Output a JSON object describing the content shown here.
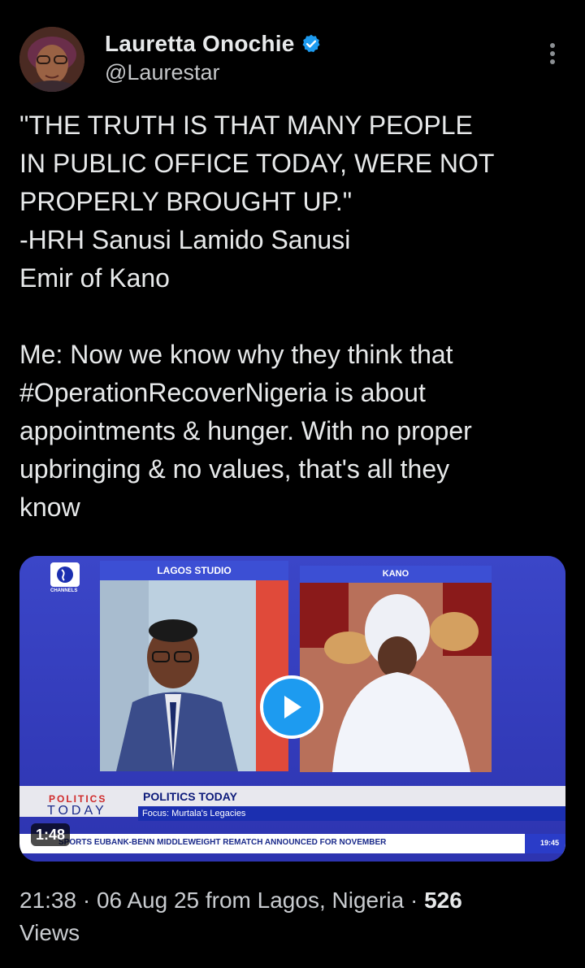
{
  "author": {
    "name": "Lauretta Onochie",
    "handle": "@Laurestar",
    "verified_color": "#1d9bf0"
  },
  "tweet": {
    "text": "\"THE TRUTH IS THAT MANY PEOPLE\nIN PUBLIC OFFICE TODAY, WERE NOT\nPROPERLY BROUGHT UP.\"\n-HRH Sanusi Lamido Sanusi\nEmir of Kano\n\nMe: Now we know why they think that\n#OperationRecoverNigeria is about\nappointments & hunger. With no proper\nupbringing & no values, that's all they\nknow"
  },
  "video": {
    "duration": "1:48",
    "left_panel_label": "LAGOS STUDIO",
    "right_panel_label": "KANO",
    "channel_logo_text": "CHANNELS",
    "show_tag_top": "POLITICS",
    "show_tag_bottom": "TODAY",
    "show_title": "POLITICS TODAY",
    "show_focus": "Focus: Murtala's Legacies",
    "ticker": "SPORTS  EUBANK-BENN MIDDLEWEIGHT REMATCH ANNOUNCED FOR NOVEMBER",
    "ticker_time": "19:45"
  },
  "meta": {
    "time": "21:38",
    "date": "06 Aug 25",
    "location_text": "from Lagos, Nigeria",
    "views_count": "526",
    "views_label": "Views"
  }
}
